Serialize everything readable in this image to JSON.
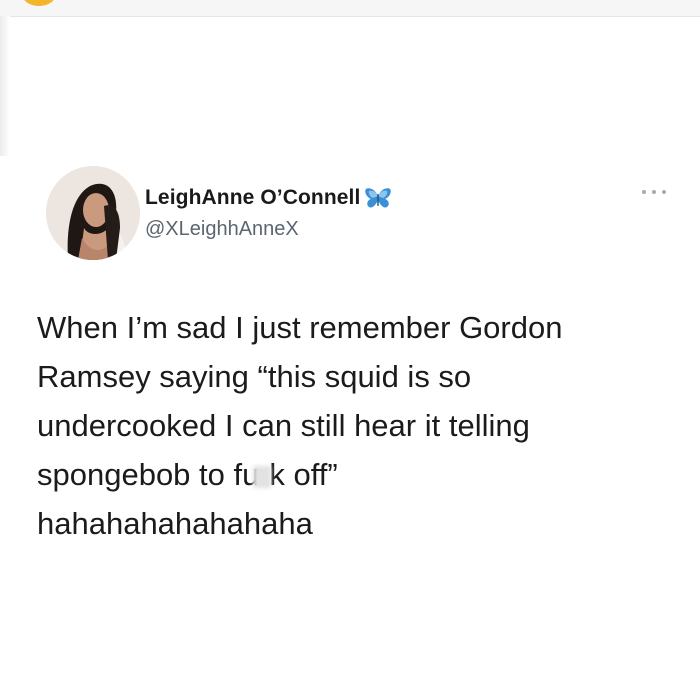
{
  "tweet": {
    "author": {
      "display_name": "LeighAnne O’Connell",
      "handle": "@XLeighhAnneX",
      "avatar": "avatar-photo",
      "name_emoji": "butterfly-icon"
    },
    "menu_icon": "more-options-icon",
    "text_lines": [
      "When I’m sad I just remember Gordon",
      "Ramsey saying “this squid is so",
      "undercooked I can still hear it telling"
    ],
    "line4_before": "spongebob to fu",
    "line4_after": "k off”",
    "line5": "hahahahahahahaha"
  },
  "colors": {
    "text": "#1b1b1b",
    "handle": "#5b6670",
    "butterfly": "#3a8fd6"
  }
}
